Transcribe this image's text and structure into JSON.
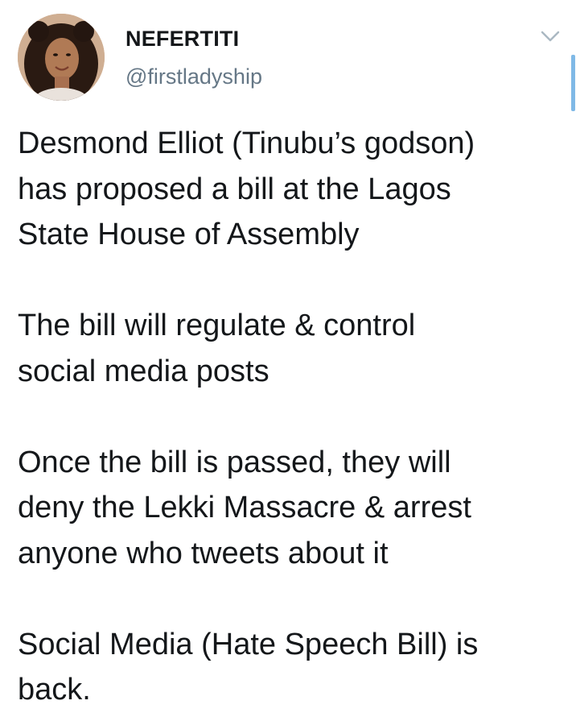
{
  "user": {
    "display_name": "NEFERTITI",
    "handle": "@firstladyship",
    "avatar_icon": "user-avatar-photo"
  },
  "controls": {
    "menu_icon": "chevron-down-icon"
  },
  "tweet": {
    "paragraphs": [
      "Desmond Elliot (Tinubu’s godson)\nhas proposed a bill at the Lagos\nState House of Assembly",
      "The bill will regulate & control\nsocial media posts",
      "Once the bill is passed, they will\ndeny the Lekki Massacre & arrest\nanyone who tweets about it",
      "Social Media (Hate Speech Bill) is\nback."
    ]
  },
  "colors": {
    "text": "#14171a",
    "secondary_text": "#657786",
    "accent": "#7fb9e6"
  }
}
